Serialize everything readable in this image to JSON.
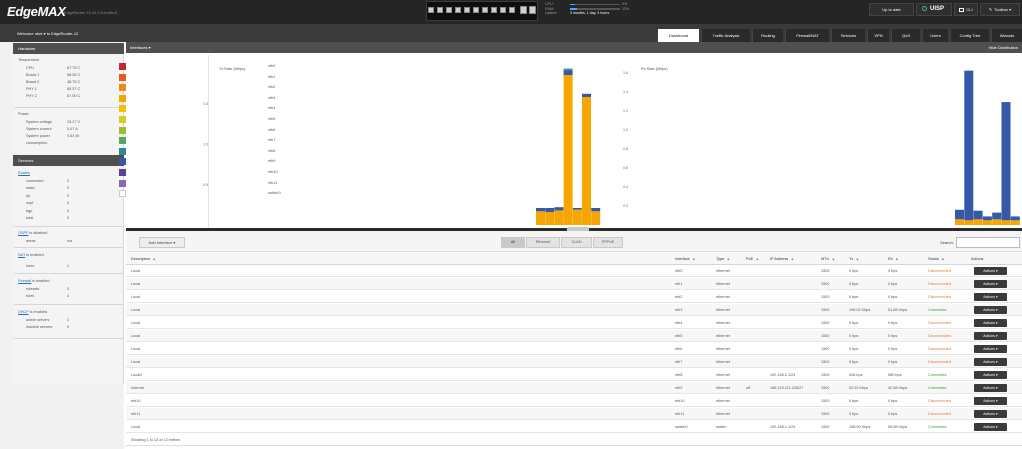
{
  "app": {
    "logo": "EdgeMAX",
    "device": "EdgeRouter 12 v2.0.9-hotfix.6"
  },
  "sysinfo": {
    "cpu_label": "CPU:",
    "cpu_pct": "9%",
    "cpu_value": 0.09,
    "ram_label": "RAM:",
    "ram_pct": "13%",
    "ram_value": 0.13,
    "uptime_label": "Uptime:",
    "uptime_value": "3 months, 1 day, 3 hours"
  },
  "ports": [
    {
      "state": "on"
    },
    {
      "state": "on"
    },
    {
      "state": "on"
    },
    {
      "state": "on"
    },
    {
      "state": "on"
    },
    {
      "state": "on"
    },
    {
      "state": "on"
    },
    {
      "state": "on"
    },
    {
      "state": "on"
    },
    {
      "state": "on"
    },
    {
      "state": "on"
    },
    {
      "state": "on"
    }
  ],
  "topbar": {
    "update_label": "Up to date",
    "uisp_label": "UISP",
    "cli_label": "CLI",
    "toolbox_label": "Toolbox ▾"
  },
  "subheader": {
    "welcome": "Welcome ubnt ▾   to EdgeRouter-12",
    "tabs": [
      {
        "label": "Dashboard",
        "active": true
      },
      {
        "label": "Traffic Analysis"
      },
      {
        "label": "Routing"
      },
      {
        "label": "Firewall/NAT"
      },
      {
        "label": "Services"
      },
      {
        "label": "VPN"
      },
      {
        "label": "QoS"
      },
      {
        "label": "Users"
      },
      {
        "label": "Config Tree"
      },
      {
        "label": "Wizards"
      }
    ]
  },
  "sidebar": {
    "hardware_title": "Hardware",
    "temperature_title": "Temperature",
    "temps": [
      {
        "label": "CPU",
        "value": "67.75 C"
      },
      {
        "label": "Board 1",
        "value": "58.06 C"
      },
      {
        "label": "Board 2",
        "value": "48.75 C"
      },
      {
        "label": "PHY 1",
        "value": "65.37 C"
      },
      {
        "label": "PHY 2",
        "value": "67.00 C"
      }
    ],
    "power_title": "Power",
    "power": [
      {
        "label": "System voltage",
        "value": "23.27 V"
      },
      {
        "label": "System current",
        "value": "0.07 A"
      },
      {
        "label": "System power",
        "value": "0.63 W"
      },
      {
        "label": "consumption",
        "value": ""
      }
    ],
    "services_title": "Services",
    "routes_link": "Routes",
    "routes": [
      {
        "label": "connected",
        "value": "0"
      },
      {
        "label": "static",
        "value": "0"
      },
      {
        "label": "rip",
        "value": "0"
      },
      {
        "label": "ospf",
        "value": "0"
      },
      {
        "label": "bgp",
        "value": "0"
      },
      {
        "label": "total",
        "value": "0"
      }
    ],
    "ospf_link": "OSPF",
    "ospf_status": " is disabled",
    "ospf_areas_label": "areas",
    "ospf_areas_value": "n/a",
    "nat_link": "NAT",
    "nat_status": " is enabled",
    "nat_rules_label": "rules",
    "nat_rules_value": "1",
    "fw_link": "Firewall",
    "fw_status": " is enabled",
    "fw_rulesets_label": "rulesets",
    "fw_rulesets_value": "3",
    "fw_rules_label": "rules",
    "fw_rules_value": "4",
    "dhcp_link": "DHCP",
    "dhcp_status": " is enabled",
    "dhcp_active_label": "active servers",
    "dhcp_active_value": "2",
    "dhcp_inactive_label": "inactive servers",
    "dhcp_inactive_value": "0"
  },
  "interfaces_panel": {
    "title": "Interfaces ▾",
    "hide_label": "Hide Distribution",
    "legend": [
      {
        "name": "eth0",
        "color": "#c1272d"
      },
      {
        "name": "eth1",
        "color": "#e45c1c"
      },
      {
        "name": "eth2",
        "color": "#ef8a17"
      },
      {
        "name": "eth3",
        "color": "#f7a500"
      },
      {
        "name": "eth4",
        "color": "#f2c100"
      },
      {
        "name": "eth5",
        "color": "#d7cc1e"
      },
      {
        "name": "eth6",
        "color": "#9cbf2e"
      },
      {
        "name": "eth7",
        "color": "#56a85a"
      },
      {
        "name": "eth8",
        "color": "#2e8b8b"
      },
      {
        "name": "eth9",
        "color": "#3558a8"
      },
      {
        "name": "eth10",
        "color": "#5a3f9e"
      },
      {
        "name": "eth11",
        "color": "#8a66b6"
      },
      {
        "name": "switch0",
        "color": "#ffffff"
      }
    ]
  },
  "chart_data": [
    {
      "type": "bar",
      "title": "Tx Rate (Mbps)",
      "ylim": [
        0,
        2.0
      ],
      "yticks": [
        {
          "v": 0.5,
          "label": "0.5"
        },
        {
          "v": 1.0,
          "label": "1.0"
        },
        {
          "v": 1.5,
          "label": "1.5"
        }
      ],
      "bars": [
        {
          "segments": [
            {
              "v": 0.17,
              "c": "#f7a500"
            },
            {
              "v": 0.04,
              "c": "#3558a8"
            }
          ]
        },
        {
          "segments": [
            {
              "v": 0.16,
              "c": "#f7a500"
            },
            {
              "v": 0.05,
              "c": "#3558a8"
            }
          ]
        },
        {
          "segments": [
            {
              "v": 0.18,
              "c": "#f7a500"
            },
            {
              "v": 0.04,
              "c": "#3558a8"
            }
          ]
        },
        {
          "segments": [
            {
              "v": 1.85,
              "c": "#f7a500"
            },
            {
              "v": 0.06,
              "c": "#3558a8"
            },
            {
              "v": 0.02,
              "c": "#2e8b8b"
            }
          ]
        },
        {
          "segments": [
            {
              "v": 0.19,
              "c": "#f7a500"
            },
            {
              "v": 0.02,
              "c": "#3558a8"
            }
          ]
        },
        {
          "segments": [
            {
              "v": 1.58,
              "c": "#f7a500"
            },
            {
              "v": 0.04,
              "c": "#3558a8"
            }
          ]
        },
        {
          "segments": [
            {
              "v": 0.17,
              "c": "#f7a500"
            },
            {
              "v": 0.04,
              "c": "#3558a8"
            }
          ]
        }
      ]
    },
    {
      "type": "bar",
      "title": "Rx Rate (Mbps)",
      "ylim": [
        0,
        1.7
      ],
      "yticks": [
        {
          "v": 0.2,
          "label": "0.2"
        },
        {
          "v": 0.4,
          "label": "0.4"
        },
        {
          "v": 0.6,
          "label": "0.6"
        },
        {
          "v": 0.8,
          "label": "0.8"
        },
        {
          "v": 1.0,
          "label": "1.0"
        },
        {
          "v": 1.2,
          "label": "1.2"
        },
        {
          "v": 1.4,
          "label": "1.4"
        },
        {
          "v": 1.6,
          "label": "1.6"
        }
      ],
      "bars": [
        {
          "segments": [
            {
              "v": 0.06,
              "c": "#f7a500"
            },
            {
              "v": 0.1,
              "c": "#3558a8"
            }
          ]
        },
        {
          "segments": [
            {
              "v": 0.05,
              "c": "#f7a500"
            },
            {
              "v": 1.57,
              "c": "#3558a8"
            }
          ]
        },
        {
          "segments": [
            {
              "v": 0.06,
              "c": "#f7a500"
            },
            {
              "v": 0.09,
              "c": "#3558a8"
            }
          ]
        },
        {
          "segments": [
            {
              "v": 0.05,
              "c": "#f7a500"
            },
            {
              "v": 0.04,
              "c": "#3558a8"
            }
          ]
        },
        {
          "segments": [
            {
              "v": 0.06,
              "c": "#f7a500"
            },
            {
              "v": 0.07,
              "c": "#3558a8"
            }
          ]
        },
        {
          "segments": [
            {
              "v": 0.05,
              "c": "#f7a500"
            },
            {
              "v": 1.24,
              "c": "#3558a8"
            }
          ]
        },
        {
          "segments": [
            {
              "v": 0.05,
              "c": "#f7a500"
            },
            {
              "v": 0.04,
              "c": "#3558a8"
            }
          ]
        }
      ]
    }
  ],
  "table": {
    "add_interface": "Add Interface ▾",
    "filters": [
      {
        "label": "All",
        "active": true
      },
      {
        "label": "Ethernet"
      },
      {
        "label": "VLAN"
      },
      {
        "label": "PPPoE"
      }
    ],
    "search_label": "Search:",
    "search_value": "",
    "columns": [
      "Description",
      "Interface",
      "Type",
      "PoE",
      "IP Address",
      "MTU",
      "Tx",
      "Rx",
      "Status",
      "Actions"
    ],
    "rows": [
      {
        "desc": "Local",
        "iface": "eth0",
        "type": "ethernet",
        "poe": "",
        "ip": "",
        "mtu": "1500",
        "tx": "0 bps",
        "rx": "0 bps",
        "status": "Disconnected",
        "action": "Actions ▾"
      },
      {
        "desc": "Local",
        "iface": "eth1",
        "type": "ethernet",
        "poe": "",
        "ip": "",
        "mtu": "1500",
        "tx": "0 bps",
        "rx": "0 bps",
        "status": "Disconnected",
        "action": "Actions ▾"
      },
      {
        "desc": "Local",
        "iface": "eth2",
        "type": "ethernet",
        "poe": "",
        "ip": "",
        "mtu": "1500",
        "tx": "0 bps",
        "rx": "0 bps",
        "status": "Disconnected",
        "action": "Actions ▾"
      },
      {
        "desc": "Local",
        "iface": "eth3",
        "type": "ethernet",
        "poe": "",
        "ip": "",
        "mtu": "1500",
        "tx": "199.02 Kbps",
        "rx": "51.88 Kbps",
        "status": "Connected",
        "action": "Actions ▾"
      },
      {
        "desc": "Local",
        "iface": "eth4",
        "type": "ethernet",
        "poe": "",
        "ip": "",
        "mtu": "1500",
        "tx": "0 bps",
        "rx": "0 bps",
        "status": "Disconnected",
        "action": "Actions ▾"
      },
      {
        "desc": "Local",
        "iface": "eth5",
        "type": "ethernet",
        "poe": "",
        "ip": "",
        "mtu": "1500",
        "tx": "0 bps",
        "rx": "0 bps",
        "status": "Disconnected",
        "action": "Actions ▾"
      },
      {
        "desc": "Local",
        "iface": "eth6",
        "type": "ethernet",
        "poe": "",
        "ip": "",
        "mtu": "1500",
        "tx": "0 bps",
        "rx": "0 bps",
        "status": "Disconnected",
        "action": "Actions ▾"
      },
      {
        "desc": "Local",
        "iface": "eth7",
        "type": "ethernet",
        "poe": "",
        "ip": "",
        "mtu": "1500",
        "tx": "0 bps",
        "rx": "0 bps",
        "status": "Disconnected",
        "action": "Actions ▾"
      },
      {
        "desc": "Local2",
        "iface": "eth8",
        "type": "ethernet",
        "poe": "",
        "ip": "192.168.2.1/24",
        "mtu": "1500",
        "tx": "528 bps",
        "rx": "560 bps",
        "status": "Connected",
        "action": "Actions ▾"
      },
      {
        "desc": "Internet",
        "iface": "eth9",
        "type": "ethernet",
        "poe": "off",
        "ip": "185.219.111.226/27",
        "mtu": "1500",
        "tx": "52.03 Kbps",
        "rx": "42.58 Kbps",
        "status": "Connected",
        "action": "Actions ▾"
      },
      {
        "desc": "eth10",
        "iface": "eth10",
        "type": "ethernet",
        "poe": "",
        "ip": "",
        "mtu": "1500",
        "tx": "0 bps",
        "rx": "0 bps",
        "status": "Disconnected",
        "action": "Actions ▾"
      },
      {
        "desc": "eth11",
        "iface": "eth11",
        "type": "ethernet",
        "poe": "",
        "ip": "",
        "mtu": "1500",
        "tx": "0 bps",
        "rx": "0 bps",
        "status": "Disconnected",
        "action": "Actions ▾"
      },
      {
        "desc": "Local",
        "iface": "switch0",
        "type": "switch",
        "poe": "",
        "ip": "192.168.1.1/24",
        "mtu": "1500",
        "tx": "198.90 Kbps",
        "rx": "55.98 Kbps",
        "status": "Connected",
        "action": "Actions ▾"
      }
    ],
    "footer": "Showing 1 to 13 of 13 entries"
  }
}
